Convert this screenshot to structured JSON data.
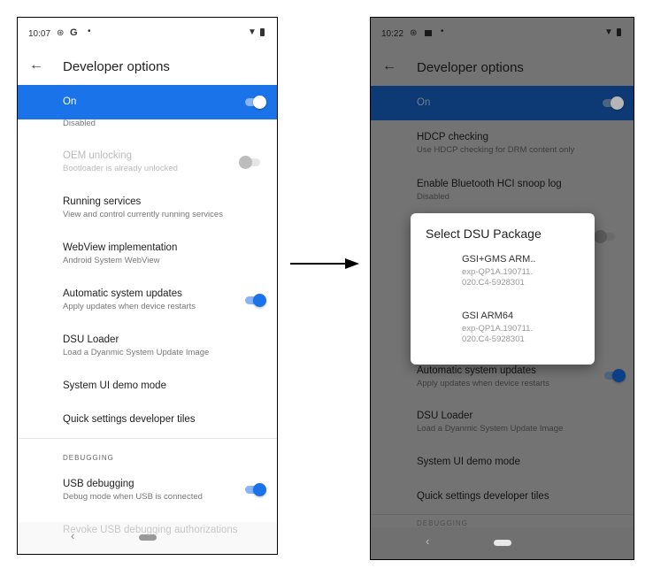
{
  "arrow": {
    "icon": "right-arrow-icon"
  },
  "left_screen": {
    "status_bar": {
      "time": "10:07",
      "icons": [
        "sync-icon",
        "google-g-icon",
        "dot-icon",
        "wifi-icon",
        "battery-icon"
      ],
      "g": "G"
    },
    "toolbar": {
      "back_icon": "back-arrow-icon",
      "title": "Developer options"
    },
    "master_switch": {
      "label": "On",
      "checked": true,
      "color": "#1a73e8"
    },
    "partial_summary": "Disabled",
    "items": [
      {
        "title": "OEM unlocking",
        "summary": "Bootloader is already unlocked",
        "toggle": false,
        "disabled": true
      },
      {
        "title": "Running services",
        "summary": "View and control currently running services"
      },
      {
        "title": "WebView implementation",
        "summary": "Android System WebView"
      },
      {
        "title": "Automatic system updates",
        "summary": "Apply updates when device restarts",
        "toggle": true
      },
      {
        "title": "DSU Loader",
        "summary": "Load a Dyanmic System Update Image"
      },
      {
        "title": "System UI demo mode"
      },
      {
        "title": "Quick settings developer tiles"
      }
    ],
    "section_header": "DEBUGGING",
    "debug_items": [
      {
        "title": "USB debugging",
        "summary": "Debug mode when USB is connected",
        "toggle": true
      },
      {
        "title": "Revoke USB debugging authorizations"
      }
    ],
    "nav": {
      "back": "‹"
    }
  },
  "right_screen": {
    "status_bar": {
      "time": "10:22",
      "icons": [
        "sync-icon",
        "image-icon",
        "dot-icon",
        "wifi-icon",
        "battery-icon"
      ]
    },
    "toolbar": {
      "title": "Developer options"
    },
    "master_switch": {
      "label": "On",
      "checked": true
    },
    "items": [
      {
        "title": "HDCP checking",
        "summary": "Use HDCP checking for DRM content only"
      },
      {
        "title": "Enable Bluetooth HCI snoop log",
        "summary": "Disabled"
      },
      {
        "title": "Automatic system updates",
        "summary": "Apply updates when device restarts",
        "toggle": true
      },
      {
        "title": "DSU Loader",
        "summary": "Load a Dyanmic System Update Image"
      },
      {
        "title": "System UI demo mode"
      },
      {
        "title": "Quick settings developer tiles"
      }
    ],
    "section_header": "DEBUGGING",
    "dialog": {
      "title": "Select DSU Package",
      "options": [
        {
          "name": "GSI+GMS ARM..",
          "version": "exp-QP1A.190711.020.C4-5928301"
        },
        {
          "name": "GSI ARM64",
          "version": "exp-QP1A.190711.020.C4-5928301"
        }
      ]
    },
    "nav": {
      "back": "‹"
    }
  }
}
